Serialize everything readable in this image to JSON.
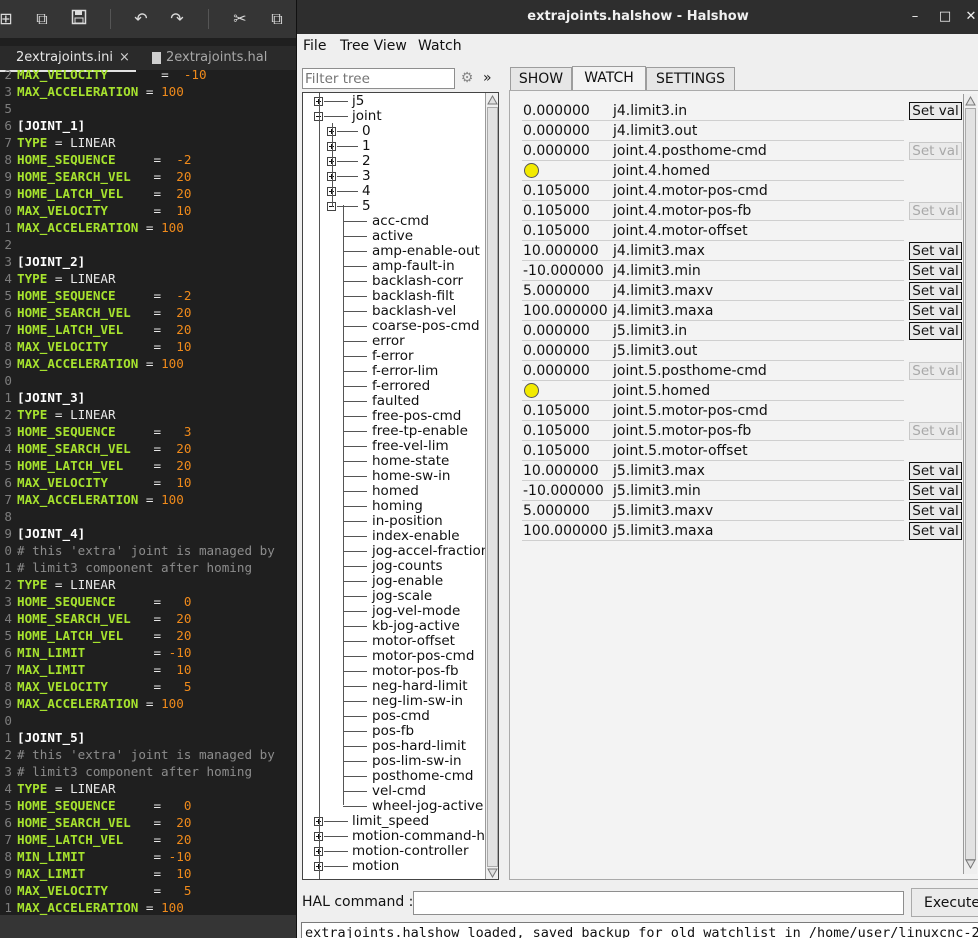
{
  "editor": {
    "toolbar_icons": [
      "add-icon",
      "copy-window-icon",
      "save-icon",
      "undo-icon",
      "redo-icon",
      "cut-icon",
      "copy-icon"
    ],
    "tabs": [
      {
        "label": "2extrajoints.ini",
        "close": "×"
      },
      {
        "label": "2extrajoints.hal"
      }
    ],
    "lines": [
      {
        "ln": "2",
        "parts": [
          [
            "k",
            "MAX_VELOCITY"
          ],
          [
            "o",
            "       =  "
          ],
          [
            "n",
            "-10"
          ]
        ]
      },
      {
        "ln": "3",
        "parts": [
          [
            "k",
            "MAX_ACCELERATION"
          ],
          [
            "o",
            " = "
          ],
          [
            "n",
            "100"
          ]
        ]
      },
      {
        "ln": "5",
        "parts": []
      },
      {
        "ln": "6",
        "parts": [
          [
            "s",
            "[JOINT_1]"
          ]
        ]
      },
      {
        "ln": "7",
        "parts": [
          [
            "k",
            "TYPE"
          ],
          [
            "o",
            " = "
          ],
          [
            "v",
            "LINEAR"
          ]
        ]
      },
      {
        "ln": "8",
        "parts": [
          [
            "k",
            "HOME_SEQUENCE"
          ],
          [
            "o",
            "     =  "
          ],
          [
            "n",
            "-2"
          ]
        ]
      },
      {
        "ln": "9",
        "parts": [
          [
            "k",
            "HOME_SEARCH_VEL"
          ],
          [
            "o",
            "   =  "
          ],
          [
            "n",
            "20"
          ]
        ]
      },
      {
        "ln": "9",
        "parts": [
          [
            "k",
            "HOME_LATCH_VEL"
          ],
          [
            "o",
            "    =  "
          ],
          [
            "n",
            "20"
          ]
        ]
      },
      {
        "ln": "0",
        "parts": [
          [
            "k",
            "MAX_VELOCITY"
          ],
          [
            "o",
            "      =  "
          ],
          [
            "n",
            "10"
          ]
        ]
      },
      {
        "ln": "1",
        "parts": [
          [
            "k",
            "MAX_ACCELERATION"
          ],
          [
            "o",
            " = "
          ],
          [
            "n",
            "100"
          ]
        ]
      },
      {
        "ln": "2",
        "parts": []
      },
      {
        "ln": "3",
        "parts": [
          [
            "s",
            "[JOINT_2]"
          ]
        ]
      },
      {
        "ln": "4",
        "parts": [
          [
            "k",
            "TYPE"
          ],
          [
            "o",
            " = "
          ],
          [
            "v",
            "LINEAR"
          ]
        ]
      },
      {
        "ln": "5",
        "parts": [
          [
            "k",
            "HOME_SEQUENCE"
          ],
          [
            "o",
            "     =  "
          ],
          [
            "n",
            "-2"
          ]
        ]
      },
      {
        "ln": "6",
        "parts": [
          [
            "k",
            "HOME_SEARCH_VEL"
          ],
          [
            "o",
            "   =  "
          ],
          [
            "n",
            "20"
          ]
        ]
      },
      {
        "ln": "7",
        "parts": [
          [
            "k",
            "HOME_LATCH_VEL"
          ],
          [
            "o",
            "    =  "
          ],
          [
            "n",
            "20"
          ]
        ]
      },
      {
        "ln": "8",
        "parts": [
          [
            "k",
            "MAX_VELOCITY"
          ],
          [
            "o",
            "      =  "
          ],
          [
            "n",
            "10"
          ]
        ]
      },
      {
        "ln": "9",
        "parts": [
          [
            "k",
            "MAX_ACCELERATION"
          ],
          [
            "o",
            " = "
          ],
          [
            "n",
            "100"
          ]
        ]
      },
      {
        "ln": "0",
        "parts": []
      },
      {
        "ln": "1",
        "parts": [
          [
            "s",
            "[JOINT_3]"
          ]
        ]
      },
      {
        "ln": "2",
        "parts": [
          [
            "k",
            "TYPE"
          ],
          [
            "o",
            " = "
          ],
          [
            "v",
            "LINEAR"
          ]
        ]
      },
      {
        "ln": "3",
        "parts": [
          [
            "k",
            "HOME_SEQUENCE"
          ],
          [
            "o",
            "     =   "
          ],
          [
            "n",
            "3"
          ]
        ]
      },
      {
        "ln": "4",
        "parts": [
          [
            "k",
            "HOME_SEARCH_VEL"
          ],
          [
            "o",
            "   =  "
          ],
          [
            "n",
            "20"
          ]
        ]
      },
      {
        "ln": "5",
        "parts": [
          [
            "k",
            "HOME_LATCH_VEL"
          ],
          [
            "o",
            "    =  "
          ],
          [
            "n",
            "20"
          ]
        ]
      },
      {
        "ln": "6",
        "parts": [
          [
            "k",
            "MAX_VELOCITY"
          ],
          [
            "o",
            "      =  "
          ],
          [
            "n",
            "10"
          ]
        ]
      },
      {
        "ln": "7",
        "parts": [
          [
            "k",
            "MAX_ACCELERATION"
          ],
          [
            "o",
            " = "
          ],
          [
            "n",
            "100"
          ]
        ]
      },
      {
        "ln": "8",
        "parts": []
      },
      {
        "ln": "9",
        "parts": [
          [
            "s",
            "[JOINT_4]"
          ]
        ]
      },
      {
        "ln": "0",
        "parts": [
          [
            "c",
            "# this 'extra' joint is managed by"
          ]
        ]
      },
      {
        "ln": "1",
        "parts": [
          [
            "c",
            "# limit3 component after homing"
          ]
        ]
      },
      {
        "ln": "2",
        "parts": [
          [
            "k",
            "TYPE"
          ],
          [
            "o",
            " = "
          ],
          [
            "v",
            "LINEAR"
          ]
        ]
      },
      {
        "ln": "3",
        "parts": [
          [
            "k",
            "HOME_SEQUENCE"
          ],
          [
            "o",
            "     =   "
          ],
          [
            "n",
            "0"
          ]
        ]
      },
      {
        "ln": "4",
        "parts": [
          [
            "k",
            "HOME_SEARCH_VEL"
          ],
          [
            "o",
            "   =  "
          ],
          [
            "n",
            "20"
          ]
        ]
      },
      {
        "ln": "5",
        "parts": [
          [
            "k",
            "HOME_LATCH_VEL"
          ],
          [
            "o",
            "    =  "
          ],
          [
            "n",
            "20"
          ]
        ]
      },
      {
        "ln": "6",
        "parts": [
          [
            "k",
            "MIN_LIMIT"
          ],
          [
            "o",
            "         = "
          ],
          [
            "n",
            "-10"
          ]
        ]
      },
      {
        "ln": "7",
        "parts": [
          [
            "k",
            "MAX_LIMIT"
          ],
          [
            "o",
            "         =  "
          ],
          [
            "n",
            "10"
          ]
        ]
      },
      {
        "ln": "8",
        "parts": [
          [
            "k",
            "MAX_VELOCITY"
          ],
          [
            "o",
            "      =   "
          ],
          [
            "n",
            "5"
          ]
        ]
      },
      {
        "ln": "9",
        "parts": [
          [
            "k",
            "MAX_ACCELERATION"
          ],
          [
            "o",
            " = "
          ],
          [
            "n",
            "100"
          ]
        ]
      },
      {
        "ln": "0",
        "parts": []
      },
      {
        "ln": "1",
        "parts": [
          [
            "s",
            "[JOINT_5]"
          ]
        ]
      },
      {
        "ln": "2",
        "parts": [
          [
            "c",
            "# this 'extra' joint is managed by"
          ]
        ]
      },
      {
        "ln": "3",
        "parts": [
          [
            "c",
            "# limit3 component after homing"
          ]
        ]
      },
      {
        "ln": "4",
        "parts": [
          [
            "k",
            "TYPE"
          ],
          [
            "o",
            " = "
          ],
          [
            "v",
            "LINEAR"
          ]
        ]
      },
      {
        "ln": "5",
        "parts": [
          [
            "k",
            "HOME_SEQUENCE"
          ],
          [
            "o",
            "     =   "
          ],
          [
            "n",
            "0"
          ]
        ]
      },
      {
        "ln": "6",
        "parts": [
          [
            "k",
            "HOME_SEARCH_VEL"
          ],
          [
            "o",
            "   =  "
          ],
          [
            "n",
            "20"
          ]
        ]
      },
      {
        "ln": "7",
        "parts": [
          [
            "k",
            "HOME_LATCH_VEL"
          ],
          [
            "o",
            "    =  "
          ],
          [
            "n",
            "20"
          ]
        ]
      },
      {
        "ln": "8",
        "parts": [
          [
            "k",
            "MIN_LIMIT"
          ],
          [
            "o",
            "         = "
          ],
          [
            "n",
            "-10"
          ]
        ]
      },
      {
        "ln": "9",
        "parts": [
          [
            "k",
            "MAX_LIMIT"
          ],
          [
            "o",
            "         =  "
          ],
          [
            "n",
            "10"
          ]
        ]
      },
      {
        "ln": "0",
        "parts": [
          [
            "k",
            "MAX_VELOCITY"
          ],
          [
            "o",
            "      =   "
          ],
          [
            "n",
            "5"
          ]
        ]
      },
      {
        "ln": "1",
        "parts": [
          [
            "k",
            "MAX_ACCELERATION"
          ],
          [
            "o",
            " = "
          ],
          [
            "n",
            "100"
          ]
        ]
      }
    ]
  },
  "halshow": {
    "title": "extrajoints.halshow - Halshow",
    "window_buttons": {
      "minimize": "–",
      "maximize": "□",
      "close": "✕"
    },
    "menu": [
      "File",
      "Tree View",
      "Watch"
    ],
    "filter": {
      "placeholder": "Filter tree",
      "gear_icon": "⚙",
      "more": "»"
    },
    "tree": [
      {
        "label": "j5",
        "level": 1,
        "expander": "plus"
      },
      {
        "label": "joint",
        "level": 1,
        "expander": "minus"
      },
      {
        "label": "0",
        "level": 2,
        "expander": "plus"
      },
      {
        "label": "1",
        "level": 2,
        "expander": "plus"
      },
      {
        "label": "2",
        "level": 2,
        "expander": "plus"
      },
      {
        "label": "3",
        "level": 2,
        "expander": "plus"
      },
      {
        "label": "4",
        "level": 2,
        "expander": "plus"
      },
      {
        "label": "5",
        "level": 2,
        "expander": "minus"
      },
      {
        "label": "acc-cmd",
        "level": 3
      },
      {
        "label": "active",
        "level": 3
      },
      {
        "label": "amp-enable-out",
        "level": 3
      },
      {
        "label": "amp-fault-in",
        "level": 3
      },
      {
        "label": "backlash-corr",
        "level": 3
      },
      {
        "label": "backlash-filt",
        "level": 3
      },
      {
        "label": "backlash-vel",
        "level": 3
      },
      {
        "label": "coarse-pos-cmd",
        "level": 3
      },
      {
        "label": "error",
        "level": 3
      },
      {
        "label": "f-error",
        "level": 3
      },
      {
        "label": "f-error-lim",
        "level": 3
      },
      {
        "label": "f-errored",
        "level": 3
      },
      {
        "label": "faulted",
        "level": 3
      },
      {
        "label": "free-pos-cmd",
        "level": 3
      },
      {
        "label": "free-tp-enable",
        "level": 3
      },
      {
        "label": "free-vel-lim",
        "level": 3
      },
      {
        "label": "home-state",
        "level": 3
      },
      {
        "label": "home-sw-in",
        "level": 3
      },
      {
        "label": "homed",
        "level": 3
      },
      {
        "label": "homing",
        "level": 3
      },
      {
        "label": "in-position",
        "level": 3
      },
      {
        "label": "index-enable",
        "level": 3
      },
      {
        "label": "jog-accel-fraction",
        "level": 3
      },
      {
        "label": "jog-counts",
        "level": 3
      },
      {
        "label": "jog-enable",
        "level": 3
      },
      {
        "label": "jog-scale",
        "level": 3
      },
      {
        "label": "jog-vel-mode",
        "level": 3
      },
      {
        "label": "kb-jog-active",
        "level": 3
      },
      {
        "label": "motor-offset",
        "level": 3
      },
      {
        "label": "motor-pos-cmd",
        "level": 3
      },
      {
        "label": "motor-pos-fb",
        "level": 3
      },
      {
        "label": "neg-hard-limit",
        "level": 3
      },
      {
        "label": "neg-lim-sw-in",
        "level": 3
      },
      {
        "label": "pos-cmd",
        "level": 3
      },
      {
        "label": "pos-fb",
        "level": 3
      },
      {
        "label": "pos-hard-limit",
        "level": 3
      },
      {
        "label": "pos-lim-sw-in",
        "level": 3
      },
      {
        "label": "posthome-cmd",
        "level": 3
      },
      {
        "label": "vel-cmd",
        "level": 3
      },
      {
        "label": "wheel-jog-active",
        "level": 3
      },
      {
        "label": "limit_speed",
        "level": 1,
        "expander": "plus"
      },
      {
        "label": "motion-command-handler",
        "level": 1,
        "expander": "plus"
      },
      {
        "label": "motion-controller",
        "level": 1,
        "expander": "plus"
      },
      {
        "label": "motion",
        "level": 1,
        "expander": "plus"
      }
    ],
    "tabs": [
      "SHOW",
      "WATCH",
      "SETTINGS"
    ],
    "active_tab": "WATCH",
    "watch": [
      {
        "value": "0.000000",
        "name": "j4.limit3.in",
        "button": "Set val",
        "button_state": "enabled"
      },
      {
        "value": "0.000000",
        "name": "j4.limit3.out"
      },
      {
        "value": "0.000000",
        "name": "joint.4.posthome-cmd",
        "button": "Set val",
        "button_state": "disabled"
      },
      {
        "led": "#f2ea00",
        "name": "joint.4.homed"
      },
      {
        "value": "0.105000",
        "name": "joint.4.motor-pos-cmd"
      },
      {
        "value": "0.105000",
        "name": "joint.4.motor-pos-fb",
        "button": "Set val",
        "button_state": "disabled"
      },
      {
        "value": "0.105000",
        "name": "joint.4.motor-offset"
      },
      {
        "value": "10.000000",
        "name": "j4.limit3.max",
        "button": "Set val",
        "button_state": "enabled"
      },
      {
        "value": "-10.000000",
        "name": "j4.limit3.min",
        "button": "Set val",
        "button_state": "enabled"
      },
      {
        "value": "5.000000",
        "name": "j4.limit3.maxv",
        "button": "Set val",
        "button_state": "enabled"
      },
      {
        "value": "100.000000",
        "name": "j4.limit3.maxa",
        "button": "Set val",
        "button_state": "enabled"
      },
      {
        "value": "0.000000",
        "name": "j5.limit3.in",
        "button": "Set val",
        "button_state": "enabled"
      },
      {
        "value": "0.000000",
        "name": "j5.limit3.out"
      },
      {
        "value": "0.000000",
        "name": "joint.5.posthome-cmd",
        "button": "Set val",
        "button_state": "disabled"
      },
      {
        "led": "#f2ea00",
        "name": "joint.5.homed"
      },
      {
        "value": "0.105000",
        "name": "joint.5.motor-pos-cmd"
      },
      {
        "value": "0.105000",
        "name": "joint.5.motor-pos-fb",
        "button": "Set val",
        "button_state": "disabled"
      },
      {
        "value": "0.105000",
        "name": "joint.5.motor-offset"
      },
      {
        "value": "10.000000",
        "name": "j5.limit3.max",
        "button": "Set val",
        "button_state": "enabled"
      },
      {
        "value": "-10.000000",
        "name": "j5.limit3.min",
        "button": "Set val",
        "button_state": "enabled"
      },
      {
        "value": "5.000000",
        "name": "j5.limit3.maxv",
        "button": "Set val",
        "button_state": "enabled"
      },
      {
        "value": "100.000000",
        "name": "j5.limit3.maxa",
        "button": "Set val",
        "button_state": "enabled"
      }
    ],
    "hal_command_label": "HAL command :",
    "hal_command_value": "",
    "execute_label": "Execute",
    "status": "extrajoints.halshow loaded, saved backup for old watchlist in /home/user/linuxcnc-2"
  }
}
